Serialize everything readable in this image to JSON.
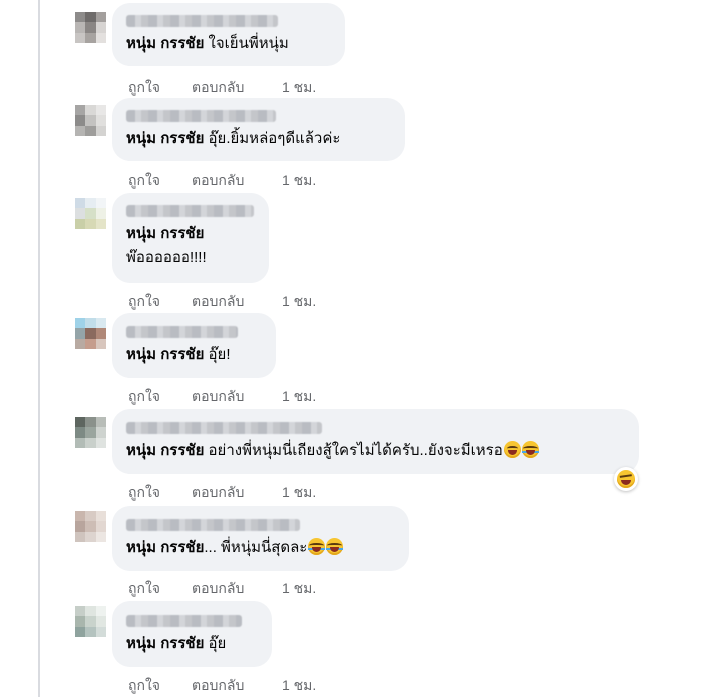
{
  "actions": {
    "like": "ถูกใจ",
    "reply": "ตอบกลับ"
  },
  "comments": [
    {
      "tag": "หนุ่ม กรรชัย",
      "text": " ใจเย็นพี่หนุ่ม",
      "time": "1 ชม.",
      "avatar": [
        "#8d8b8a",
        "#6e6b6a",
        "#a39f9d",
        "#b9b6b4",
        "#8a8684",
        "#d7d4d2",
        "#c8c5c3",
        "#a7a3a0",
        "#e3e0de"
      ]
    },
    {
      "tag": "หนุ่ม กรรชัย",
      "text": " อุ๊ย.ยิ้มหล่อๆดีแล้วค่ะ",
      "time": "1 ชม.",
      "avatar": [
        "#a6a5a4",
        "#d9d8d6",
        "#e8e7e6",
        "#8c8b8a",
        "#c3c2c0",
        "#e0dfdd",
        "#b5b4b2",
        "#9e9d9b",
        "#d4d3d1"
      ]
    },
    {
      "tag": "หนุ่ม กรรชัย",
      "line2": "พ๊ออออออ!!!!",
      "time": "1 ชม.",
      "avatar": [
        "#cfdbe6",
        "#e6edf2",
        "#f2f5f7",
        "#dcdfe0",
        "#d6e0c8",
        "#eef1e6",
        "#c9cfa8",
        "#d7d9b5",
        "#e4e4c8"
      ]
    },
    {
      "tag": "หนุ่ม กรรชัย",
      "text": " อุ๊ย!",
      "time": "1 ชม.",
      "avatar": [
        "#9fd2e8",
        "#c1dde9",
        "#d9e9f0",
        "#94a4a8",
        "#8b6a5e",
        "#b08878",
        "#b8aaa2",
        "#c59d8d",
        "#d8c6bd"
      ]
    },
    {
      "tag": "หนุ่ม กรรชัย",
      "text": " อย่างพี่หนุ่มนี่เถียงสู้ใครไม่ได้ครับ..ยังจะมีเหรอ",
      "time": "1 ชม.",
      "emojis": [
        "grin",
        "laugh-tear"
      ],
      "avatar": [
        "#5e6660",
        "#8a918b",
        "#b8bdb8",
        "#7d8a84",
        "#9aa59e",
        "#ced3cf",
        "#b2bcb6",
        "#c9d0cb",
        "#dfe3e0"
      ]
    },
    {
      "tag": "หนุ่ม กรรชัย",
      "text": "... พี่หนุ่มนี่สุดละ",
      "time": "1 ชม.",
      "emojis": [
        "laugh-tear",
        "laugh-tear"
      ],
      "avatar": [
        "#c9b6ad",
        "#d8cbc4",
        "#e8dfd9",
        "#b8a59d",
        "#cdbdb5",
        "#e2d7d1",
        "#cfc4be",
        "#ddd4cf",
        "#ece6e2"
      ]
    },
    {
      "tag": "หนุ่ม กรรชัย",
      "text": " อุ๊ย",
      "time": "1 ชม.",
      "avatar": [
        "#c6cec8",
        "#dfe5e0",
        "#eef2ef",
        "#a9b6ad",
        "#c9d3cc",
        "#e1e7e2",
        "#8fa39e",
        "#b4c3bf",
        "#d3dcd9"
      ]
    }
  ]
}
